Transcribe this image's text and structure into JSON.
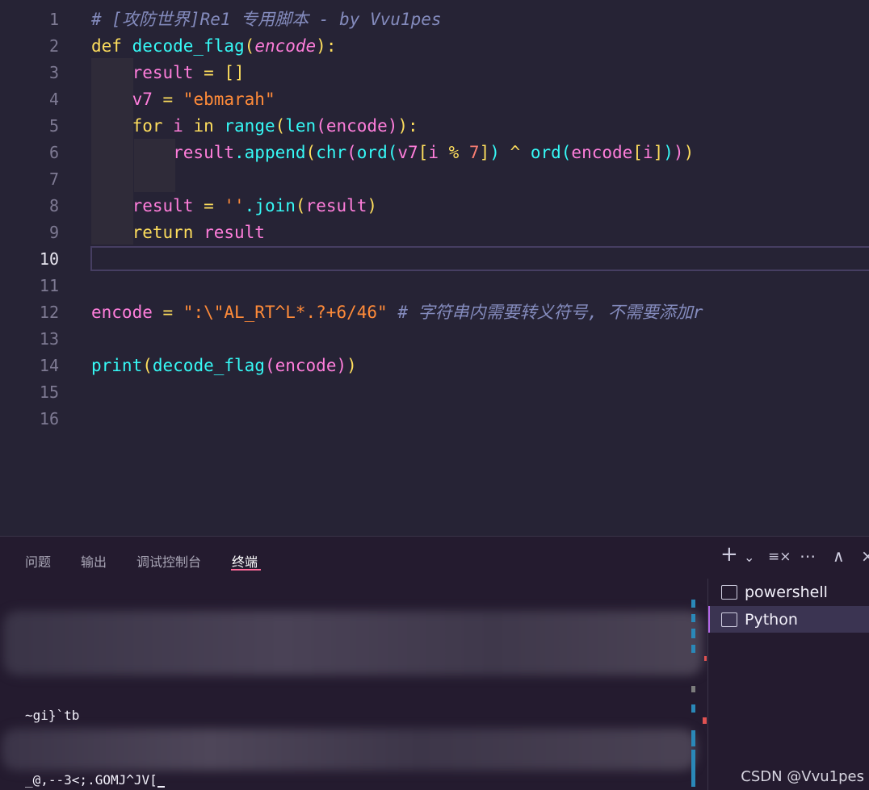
{
  "editor": {
    "line_numbers": [
      "1",
      "2",
      "3",
      "4",
      "5",
      "6",
      "7",
      "8",
      "9",
      "10",
      "11",
      "12",
      "13",
      "14",
      "15",
      "16"
    ],
    "active_line": "10",
    "lines": [
      [
        {
          "t": "# [攻防世界]Re1 专用脚本 - by Vvu1pes",
          "c": "cm"
        }
      ],
      [
        {
          "t": "def ",
          "c": "kw"
        },
        {
          "t": "decode_flag",
          "c": "fn"
        },
        {
          "t": "(",
          "c": "br1"
        },
        {
          "t": "encode",
          "c": "par"
        },
        {
          "t": "):",
          "c": "br1"
        }
      ],
      [
        {
          "t": "    result",
          "c": "ident"
        },
        {
          "t": " = ",
          "c": "op"
        },
        {
          "t": "[]",
          "c": "br1"
        }
      ],
      [
        {
          "t": "    v7",
          "c": "ident"
        },
        {
          "t": " = ",
          "c": "op"
        },
        {
          "t": "\"ebmarah\"",
          "c": "str"
        }
      ],
      [
        {
          "t": "    for ",
          "c": "kw"
        },
        {
          "t": "i ",
          "c": "ident"
        },
        {
          "t": "in ",
          "c": "kw"
        },
        {
          "t": "range",
          "c": "fn"
        },
        {
          "t": "(",
          "c": "br1"
        },
        {
          "t": "len",
          "c": "fn"
        },
        {
          "t": "(",
          "c": "br2"
        },
        {
          "t": "encode",
          "c": "ident"
        },
        {
          "t": ")",
          "c": "br2"
        },
        {
          "t": "):",
          "c": "br1"
        }
      ],
      [
        {
          "t": "        result",
          "c": "ident"
        },
        {
          "t": ".append",
          "c": "fn"
        },
        {
          "t": "(",
          "c": "br1"
        },
        {
          "t": "chr",
          "c": "fn"
        },
        {
          "t": "(",
          "c": "br2"
        },
        {
          "t": "ord",
          "c": "fn"
        },
        {
          "t": "(",
          "c": "br3"
        },
        {
          "t": "v7",
          "c": "ident"
        },
        {
          "t": "[",
          "c": "br1"
        },
        {
          "t": "i ",
          "c": "ident"
        },
        {
          "t": "% ",
          "c": "op"
        },
        {
          "t": "7",
          "c": "num"
        },
        {
          "t": "]",
          "c": "br1"
        },
        {
          "t": ")",
          "c": "br3"
        },
        {
          "t": " ^ ",
          "c": "op"
        },
        {
          "t": "ord",
          "c": "fn"
        },
        {
          "t": "(",
          "c": "br3"
        },
        {
          "t": "encode",
          "c": "ident"
        },
        {
          "t": "[",
          "c": "br1"
        },
        {
          "t": "i",
          "c": "ident"
        },
        {
          "t": "]",
          "c": "br1"
        },
        {
          "t": ")",
          "c": "br3"
        },
        {
          "t": ")",
          "c": "br2"
        },
        {
          "t": ")",
          "c": "br1"
        }
      ],
      [],
      [
        {
          "t": "    result",
          "c": "ident"
        },
        {
          "t": " = ",
          "c": "op"
        },
        {
          "t": "''",
          "c": "str"
        },
        {
          "t": ".join",
          "c": "fn"
        },
        {
          "t": "(",
          "c": "br1"
        },
        {
          "t": "result",
          "c": "ident"
        },
        {
          "t": ")",
          "c": "br1"
        }
      ],
      [
        {
          "t": "    return ",
          "c": "kw"
        },
        {
          "t": "result",
          "c": "ident"
        }
      ],
      [],
      [],
      [
        {
          "t": "encode",
          "c": "ident"
        },
        {
          "t": " = ",
          "c": "op"
        },
        {
          "t": "\":\\\"AL_RT^L*.?+6/46\"",
          "c": "str"
        },
        {
          "t": " # 字符串内需要转义符号, 不需要添加r",
          "c": "cm"
        }
      ],
      [],
      [
        {
          "t": "print",
          "c": "fn"
        },
        {
          "t": "(",
          "c": "br1"
        },
        {
          "t": "decode_flag",
          "c": "fn"
        },
        {
          "t": "(",
          "c": "br2"
        },
        {
          "t": "encode",
          "c": "ident"
        },
        {
          "t": ")",
          "c": "br2"
        },
        {
          "t": ")",
          "c": "br1"
        }
      ],
      [],
      []
    ]
  },
  "panel": {
    "tabs": [
      "问题",
      "输出",
      "调试控制台",
      "终端"
    ],
    "active_tab": "终端",
    "terminal_output": [
      "~gi}`tb",
      "_@,--3<;.GOMJ^JV["
    ],
    "terminals": [
      {
        "label": "powershell",
        "selected": false
      },
      {
        "label": "Python",
        "selected": true
      }
    ],
    "tools": {
      "add": "+",
      "dropdown": "⌄",
      "clear": "≡×",
      "more": "⋯",
      "maximize": "∧",
      "close": "×"
    }
  },
  "watermark": "CSDN @Vvu1pes",
  "colors": {
    "editor_bg": "#262335",
    "panel_bg": "#241b2f",
    "keyword": "#fede5d",
    "function": "#36f9f6",
    "identifier": "#ff7edb",
    "string": "#ff8b39",
    "comment": "#848bbd",
    "active_tab_underline": "#ff6b9a"
  }
}
